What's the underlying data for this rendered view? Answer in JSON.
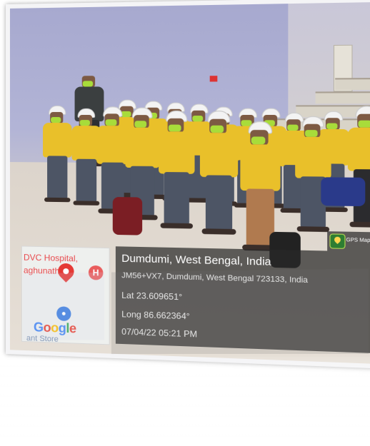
{
  "gps_overlay": {
    "app_badge": "GPS Map Camera",
    "location_title": "Dumdumi, West Bengal, India",
    "address": "JM56+VX7, Dumdumi, West Bengal 723133, India",
    "latitude": "Lat 23.609651°",
    "longitude": "Long 86.662364°",
    "datetime": "07/04/22 05:21 PM"
  },
  "map_thumbnail": {
    "label_line1": "DVC Hospital,",
    "label_line2": "aghunathpur",
    "provider": "Google",
    "store_label": "ant Store",
    "icons": [
      "location-pin-icon",
      "hospital-icon",
      "store-icon"
    ]
  },
  "colors": {
    "shirt": "#e9c02a",
    "mask": "#a8dc3a",
    "overlay_bg": "rgba(40,40,40,0.72)",
    "pin": "#e53935"
  }
}
